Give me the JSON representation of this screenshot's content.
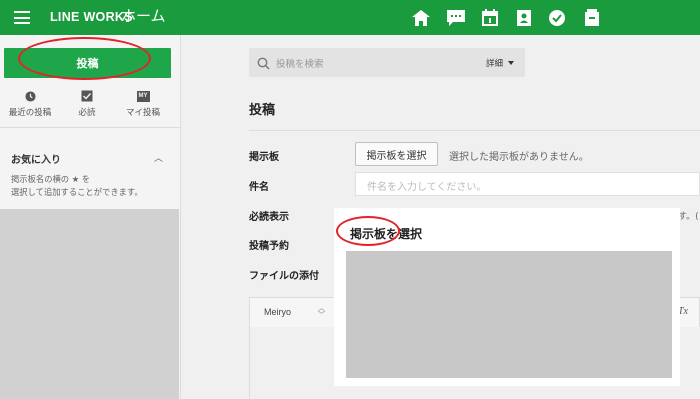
{
  "header": {
    "brand": "LINE WORKS",
    "brand_sub": "ホーム",
    "nav_icons": [
      "home-icon",
      "chat-icon",
      "calendar-icon",
      "contacts-icon",
      "check-icon",
      "drive-icon"
    ],
    "colors": {
      "bar": "#1a9c3e",
      "icon": "#ffffff"
    }
  },
  "sidebar": {
    "post_button": "投稿",
    "quick_links": [
      {
        "label": "最近の投稿",
        "icon": "clock-icon"
      },
      {
        "label": "必読",
        "icon": "checkbox-icon"
      },
      {
        "label": "マイ投稿",
        "icon": "my-badge-icon",
        "badge": "MY"
      }
    ],
    "favorites_title": "お気に入り",
    "favorites_desc_line1": "掲示板名の横の ★ を",
    "favorites_desc_line2": "選択して追加することができます。"
  },
  "search": {
    "placeholder": "投稿を検索",
    "detail_label": "詳細"
  },
  "form": {
    "title": "投稿",
    "board_label": "掲示板",
    "board_button": "掲示板を選択",
    "board_message": "選択した掲示板がありません。",
    "subject_label": "件名",
    "subject_placeholder": "件名を入力してください。",
    "required_label": "必読表示",
    "required_cut": "す。(",
    "schedule_label": "投稿予約",
    "attach_label": "ファイルの添付",
    "editor_font": "Meiryo",
    "editor_clear": "Tx"
  },
  "modal": {
    "title": "掲示板を選択"
  },
  "annotation_color": "#e2232a"
}
